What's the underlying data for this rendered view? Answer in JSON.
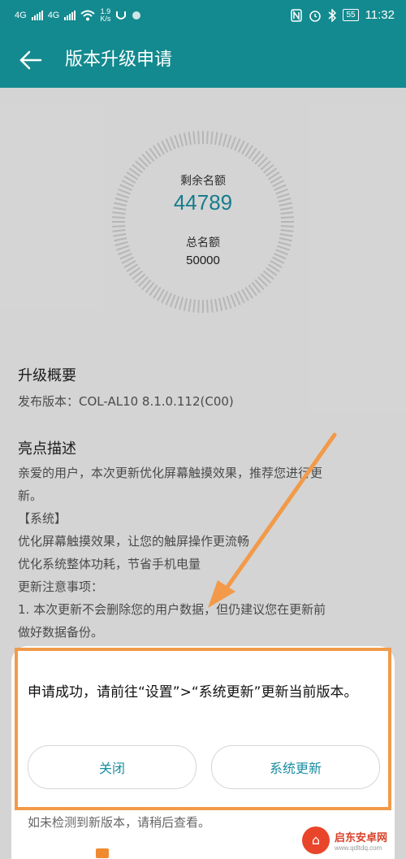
{
  "status_bar": {
    "signal1_label": "4G",
    "signal2_label": "4G",
    "speed_value": "1.9",
    "speed_unit": "K/s",
    "battery": "55",
    "time": "11:32"
  },
  "header": {
    "title": "版本升级申请"
  },
  "quota": {
    "remaining_label": "剩余名额",
    "remaining_value": "44789",
    "total_label": "总名额",
    "total_value": "50000"
  },
  "overview": {
    "heading": "升级概要",
    "version_line": "发布版本：COL-AL10 8.1.0.112(C00)"
  },
  "highlights": {
    "heading": "亮点描述",
    "lines": [
      "亲爱的用户，本次更新优化屏幕触摸效果，推荐您进行更",
      "新。",
      "【系统】",
      "优化屏幕触摸效果，让您的触屏操作更流畅",
      "优化系统整体功耗，节省手机电量",
      "更新注意事项：",
      "1. 本次更新不会删除您的用户数据，但仍建议您在更新前",
      "做好数据备份。"
    ]
  },
  "dialog": {
    "message": "申请成功，请前往“设置”>“系统更新”更新当前版本。",
    "close_label": "关闭",
    "update_label": "系统更新",
    "note": "如未检测到新版本，请稍后查看。"
  },
  "watermark": {
    "name": "启东安卓网",
    "url": "www.qdltdq.com"
  },
  "colors": {
    "header_bg": "#138a8f",
    "accent": "#1a8ea0",
    "annotation": "#f29a4a"
  }
}
